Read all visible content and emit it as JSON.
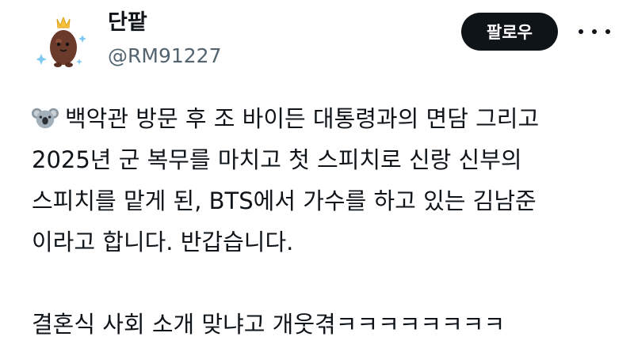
{
  "user": {
    "display_name": "단팥",
    "handle": "@RM91227"
  },
  "actions": {
    "follow_label": "팔로우",
    "more_icon": "more-horizontal-icon"
  },
  "post": {
    "emoji_icon": "koala-emoji-icon",
    "lines": [
      "백악관 방문 후 조 바이든 대통령과의 면담 그리고",
      "2025년 군 복무를 마치고 첫 스피치로 신랑 신부의",
      "스피치를 맡게 된, BTS에서 가수를 하고 있는 김남준",
      "이라고 합니다. 반갑습니다."
    ],
    "last_line": "결혼식 사회 소개 맞냐고 개웃겪ㅋㅋㅋㅋㅋㅋㅋㅋ"
  }
}
